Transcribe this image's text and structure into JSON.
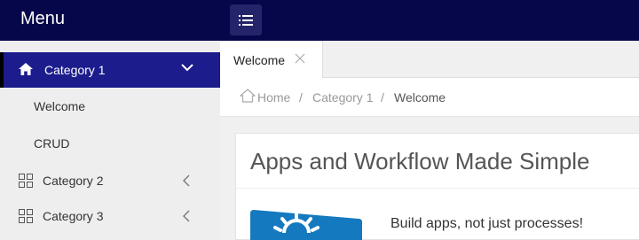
{
  "header": {
    "brand": "Menu",
    "menu_toggle_icon": "list-icon"
  },
  "sidebar": {
    "active_category": {
      "label": "Category 1",
      "icon": "home-icon",
      "expanded": true
    },
    "sub_items": [
      {
        "label": "Welcome"
      },
      {
        "label": "CRUD"
      }
    ],
    "categories": [
      {
        "label": "Category 2",
        "icon": "grid-icon"
      },
      {
        "label": "Category 3",
        "icon": "grid-icon"
      }
    ]
  },
  "tabs": [
    {
      "label": "Welcome",
      "closable": true,
      "active": true
    }
  ],
  "breadcrumb": {
    "items": [
      "Home",
      "Category 1",
      "Welcome"
    ],
    "separator": "/"
  },
  "content": {
    "title": "Apps and Workflow Made Simple",
    "tagline": "Build apps, not just processes!"
  },
  "colors": {
    "topbar": "#06064a",
    "sidebar_active": "#1c1c8c",
    "logo_blue": "#1479bf"
  }
}
